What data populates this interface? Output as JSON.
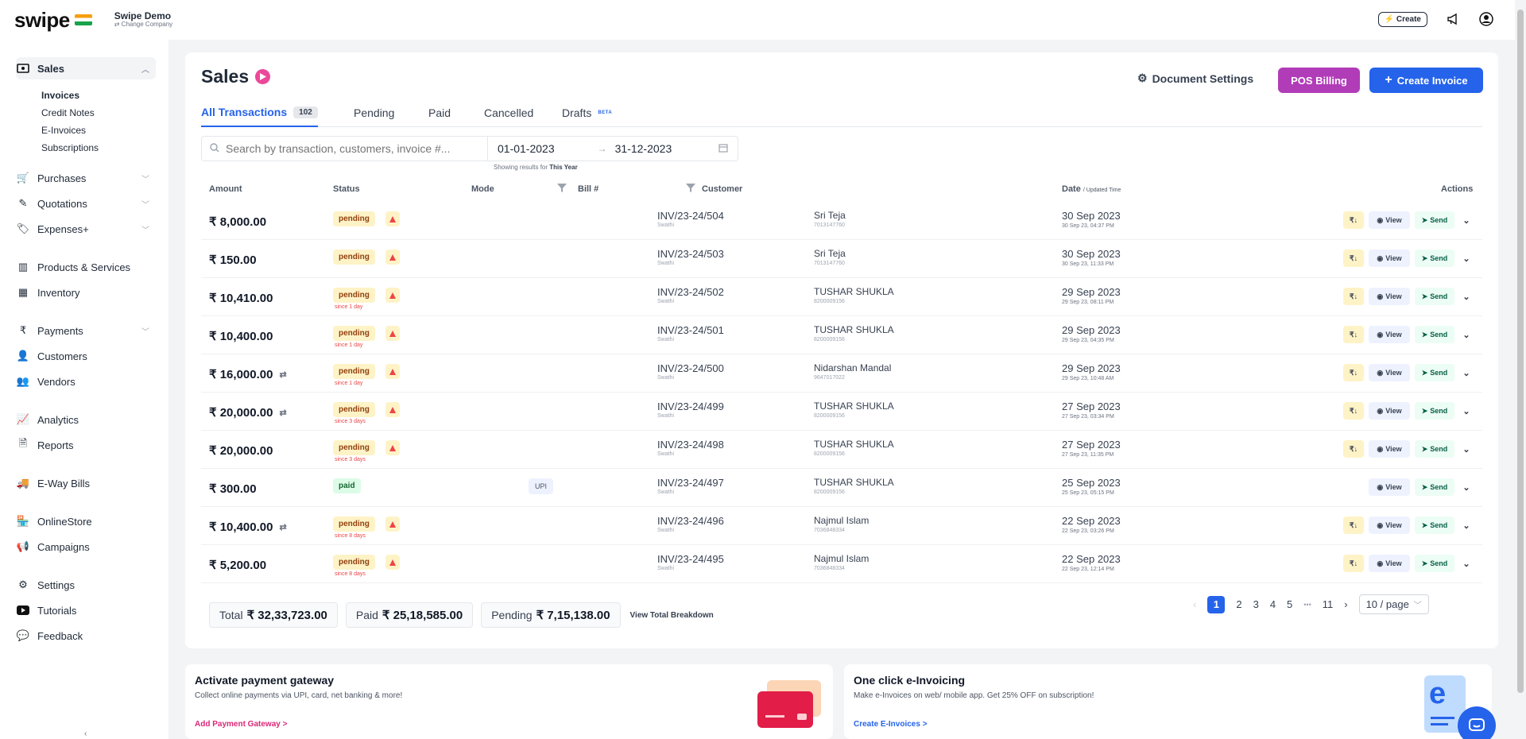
{
  "topbar": {
    "logo": "swipe",
    "company_name": "Swipe Demo",
    "change_company": "⇄ Change Company",
    "create_label": "⚡ Create"
  },
  "sidebar": {
    "sales": "Sales",
    "sub_items": [
      "Invoices",
      "Credit Notes",
      "E-Invoices",
      "Subscriptions"
    ],
    "items": [
      "Purchases",
      "Quotations",
      "Expenses+",
      "Products & Services",
      "Inventory",
      "Payments",
      "Customers",
      "Vendors",
      "Analytics",
      "Reports",
      "E-Way Bills",
      "OnlineStore",
      "Campaigns",
      "Settings",
      "Tutorials",
      "Feedback"
    ]
  },
  "header": {
    "title": "Sales",
    "document_settings": "Document Settings",
    "pos_billing": "POS Billing",
    "create_invoice": "Create Invoice"
  },
  "tabs": {
    "all": "All Transactions",
    "all_count": "102",
    "pending": "Pending",
    "paid": "Paid",
    "cancelled": "Cancelled",
    "drafts": "Drafts",
    "beta": "BETA"
  },
  "filters": {
    "search_placeholder": "Search by transaction, customers, invoice #...",
    "date_from": "01-01-2023",
    "date_to": "31-12-2023",
    "showing_prefix": "Showing results for",
    "showing_period": "This Year"
  },
  "table": {
    "headers": {
      "amount": "Amount",
      "status": "Status",
      "mode": "Mode",
      "bill": "Bill #",
      "customer": "Customer",
      "date": "Date",
      "date_sub": "/ Updated Time",
      "actions": "Actions"
    },
    "action_labels": {
      "rupee": "₹↓",
      "view": "View",
      "send": "Send"
    },
    "rows": [
      {
        "amount": "₹ 8,000.00",
        "status": "pending",
        "since": "",
        "mode": "",
        "bill": "INV/23-24/504",
        "bill_sub": "Swathi",
        "customer": "Sri Teja",
        "phone": "7013147760",
        "date": "30 Sep 2023",
        "time": "30 Sep 23, 04:37 PM"
      },
      {
        "amount": "₹ 150.00",
        "status": "pending",
        "since": "",
        "mode": "",
        "bill": "INV/23-24/503",
        "bill_sub": "Swathi",
        "customer": "Sri Teja",
        "phone": "7013147760",
        "date": "30 Sep 2023",
        "time": "30 Sep 23, 11:33 PM"
      },
      {
        "amount": "₹ 10,410.00",
        "status": "pending",
        "since": "since 1 day",
        "mode": "",
        "bill": "INV/23-24/502",
        "bill_sub": "Swathi",
        "customer": "TUSHAR SHUKLA",
        "phone": "8200009156",
        "date": "29 Sep 2023",
        "time": "29 Sep 23, 08:11 PM"
      },
      {
        "amount": "₹ 10,400.00",
        "status": "pending",
        "since": "since 1 day",
        "mode": "",
        "bill": "INV/23-24/501",
        "bill_sub": "Swathi",
        "customer": "TUSHAR SHUKLA",
        "phone": "8200009156",
        "date": "29 Sep 2023",
        "time": "29 Sep 23, 04:35 PM"
      },
      {
        "amount": "₹ 16,000.00",
        "status": "pending",
        "since": "since 1 day",
        "mode": "",
        "bill": "INV/23-24/500",
        "bill_sub": "Swathi",
        "customer": "Nidarshan Mandal",
        "phone": "9647017022",
        "date": "29 Sep 2023",
        "time": "29 Sep 23, 10:48 AM"
      },
      {
        "amount": "₹ 20,000.00",
        "status": "pending",
        "since": "since 3 days",
        "mode": "",
        "bill": "INV/23-24/499",
        "bill_sub": "Swathi",
        "customer": "TUSHAR SHUKLA",
        "phone": "8200009156",
        "date": "27 Sep 2023",
        "time": "27 Sep 23, 03:34 PM"
      },
      {
        "amount": "₹ 20,000.00",
        "status": "pending",
        "since": "since 3 days",
        "mode": "",
        "bill": "INV/23-24/498",
        "bill_sub": "Swathi",
        "customer": "TUSHAR SHUKLA",
        "phone": "8200009156",
        "date": "27 Sep 2023",
        "time": "27 Sep 23, 11:35 PM"
      },
      {
        "amount": "₹ 300.00",
        "status": "paid",
        "since": "",
        "mode": "UPI",
        "bill": "INV/23-24/497",
        "bill_sub": "Swathi",
        "customer": "TUSHAR SHUKLA",
        "phone": "8200009156",
        "date": "25 Sep 2023",
        "time": "25 Sep 23, 05:15 PM"
      },
      {
        "amount": "₹ 10,400.00",
        "status": "pending",
        "since": "since 8 days",
        "mode": "",
        "bill": "INV/23-24/496",
        "bill_sub": "Swathi",
        "customer": "Najmul Islam",
        "phone": "7036848334",
        "date": "22 Sep 2023",
        "time": "22 Sep 23, 03:26 PM"
      },
      {
        "amount": "₹ 5,200.00",
        "status": "pending",
        "since": "since 8 days",
        "mode": "",
        "bill": "INV/23-24/495",
        "bill_sub": "Swathi",
        "customer": "Najmul Islam",
        "phone": "7036848334",
        "date": "22 Sep 2023",
        "time": "22 Sep 23, 12:14 PM"
      }
    ]
  },
  "totals": {
    "total_label": "Total",
    "total_value": "₹ 32,33,723.00",
    "paid_label": "Paid",
    "paid_value": "₹ 25,18,585.00",
    "pending_label": "Pending",
    "pending_value": "₹ 7,15,138.00",
    "breakdown": "View Total Breakdown"
  },
  "pagination": {
    "pages": [
      "1",
      "2",
      "3",
      "4",
      "5"
    ],
    "ellipsis": "•••",
    "last": "11",
    "per_page": "10 / page"
  },
  "promos": {
    "gateway_title": "Activate payment gateway",
    "gateway_sub": "Collect online payments via UPI, card, net banking & more!",
    "gateway_link": "Add Payment Gateway >",
    "einv_title": "One click e-Invoicing",
    "einv_sub": "Make e-Invoices on web/ mobile app. Get 25% OFF on subscription!",
    "einv_link": "Create E-Invoices >"
  },
  "colors": {
    "primary": "#2563eb",
    "pos": "#b13cb8",
    "pending_bg": "#fef3c7",
    "paid_bg": "#dcfce7",
    "play": "#ec4899"
  }
}
